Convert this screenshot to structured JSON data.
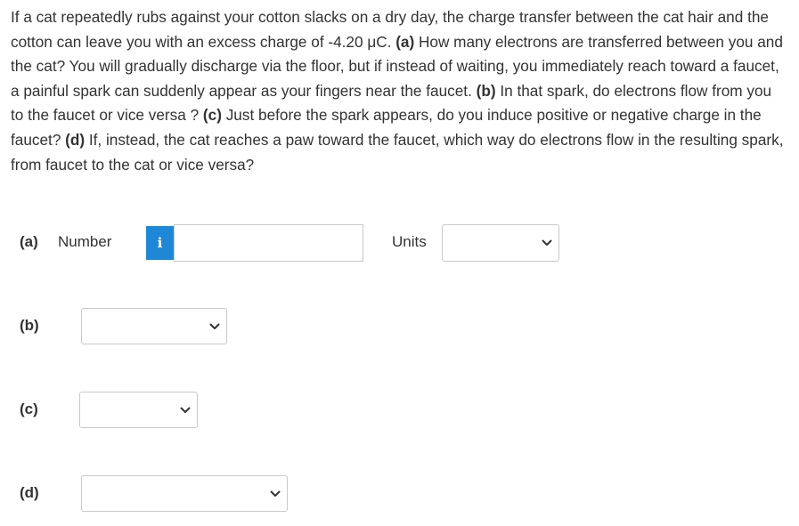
{
  "question": {
    "intro": "If a cat repeatedly rubs against your cotton slacks on a dry day, the charge transfer between the cat hair and the cotton can leave you with an excess charge of -4.20 μC. ",
    "part_a_label": "(a)",
    "part_a_text": " How many electrons are transferred between you and the cat? You will gradually discharge via the floor, but if instead of waiting, you immediately reach toward a faucet, a painful spark can suddenly appear as your fingers near the faucet. ",
    "part_b_label": "(b)",
    "part_b_text": " In that spark, do electrons flow from you to the faucet or vice versa ? ",
    "part_c_label": "(c)",
    "part_c_text": " Just before the spark appears, do you induce positive or negative charge in the faucet? ",
    "part_d_label": "(d)",
    "part_d_text": " If, instead, the cat reaches a paw toward the faucet, which way do electrons flow in the resulting spark, from faucet to the cat or vice versa?"
  },
  "answers": {
    "a": {
      "label": "(a)",
      "number_label": "Number",
      "info_glyph": "i",
      "number_value": "",
      "units_label": "Units",
      "units_selected": ""
    },
    "b": {
      "label": "(b)",
      "selected": ""
    },
    "c": {
      "label": "(c)",
      "selected": ""
    },
    "d": {
      "label": "(d)",
      "selected": ""
    }
  },
  "colors": {
    "info_button": "#1e88d6",
    "border": "#c9c9c9",
    "text": "#333333"
  },
  "icons": {
    "info": "info-icon",
    "dropdown": "chevron-down-icon"
  }
}
